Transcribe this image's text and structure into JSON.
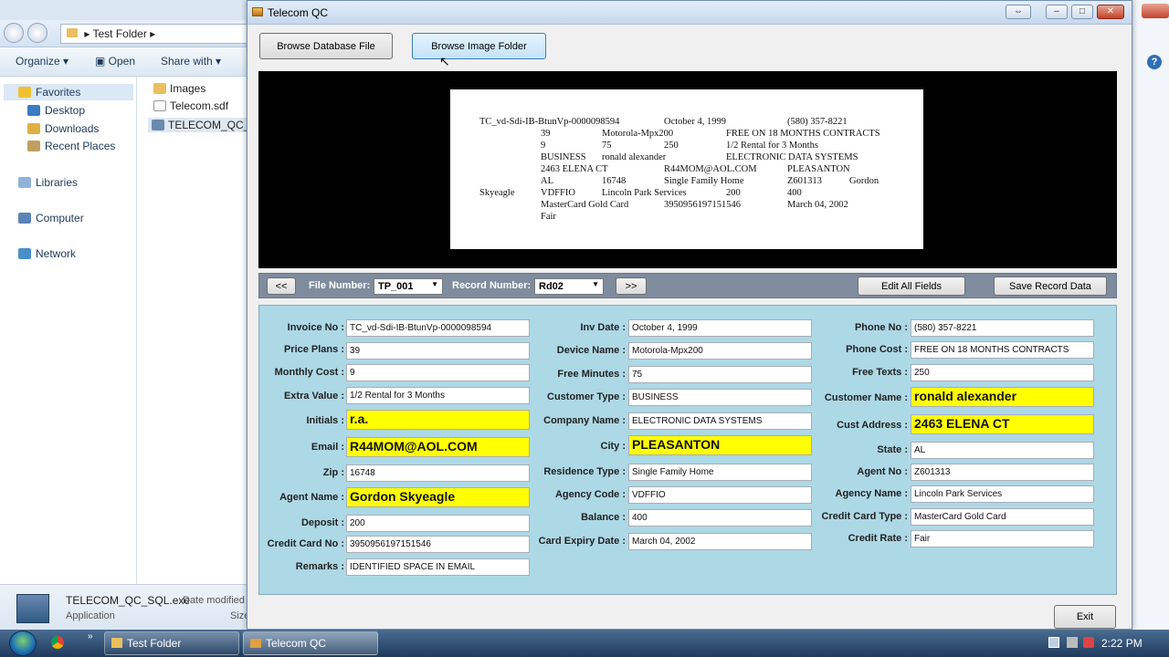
{
  "explorer": {
    "path": [
      "Test Folder"
    ],
    "toolbar": {
      "organize": "Organize",
      "open": "Open",
      "share": "Share with"
    },
    "nav": [
      "Favorites",
      "Desktop",
      "Downloads",
      "Recent Places",
      "Libraries",
      "Computer",
      "Network"
    ],
    "files": [
      "Images",
      "Telecom.sdf",
      "TELECOM_QC_SQ"
    ],
    "details": {
      "name": "TELECOM_QC_SQL.exe",
      "meta": "Date modified",
      "type": "Application",
      "size": "Size"
    }
  },
  "window": {
    "title": "Telecom QC",
    "buttons": {
      "browse_db": "Browse Database File",
      "browse_img": "Browse Image Folder",
      "prev": "<<",
      "next": ">>",
      "edit_all": "Edit All Fields",
      "save": "Save Record Data",
      "exit": "Exit"
    },
    "nav": {
      "file_label": "File Number:",
      "file_value": "TP_001",
      "record_label": "Record Number:",
      "record_value": "Rd02"
    },
    "document_lines": [
      [
        "TC_vd-Sdi-IB-BtunVp-0000098594",
        "October 4, 1999",
        "(580) 357-8221"
      ],
      [
        "39",
        "Motorola-Mpx200",
        "FREE ON 18 MONTHS CONTRACTS"
      ],
      [
        "9",
        "75",
        "250",
        "1/2 Rental for 3 Months"
      ],
      [
        "BUSINESS",
        "ronald alexander",
        "ELECTRONIC DATA SYSTEMS"
      ],
      [
        "2463 ELENA CT",
        "R44MOM@AOL.COM",
        "PLEASANTON"
      ],
      [
        "AL",
        "16748",
        "Single Family Home",
        "Z601313",
        "Gordon"
      ],
      [
        "Skyeagle",
        "VDFFIO",
        "Lincoln Park Services",
        "200",
        "400"
      ],
      [
        "MasterCard Gold Card",
        "3950956197151546",
        "March 04, 2002"
      ],
      [
        "Fair"
      ]
    ],
    "fields": {
      "invoice_no": {
        "label": "Invoice No :",
        "value": "TC_vd-Sdi-IB-BtunVp-0000098594"
      },
      "price_plans": {
        "label": "Price Plans :",
        "value": "39"
      },
      "monthly_cost": {
        "label": "Monthly Cost :",
        "value": "9"
      },
      "extra_value": {
        "label": "Extra Value :",
        "value": "1/2 Rental for 3 Months"
      },
      "initials": {
        "label": "Initials :",
        "value": "r.a."
      },
      "email": {
        "label": "Email :",
        "value": "R44MOM@AOL.COM"
      },
      "zip": {
        "label": "Zip :",
        "value": "16748"
      },
      "agent_name": {
        "label": "Agent Name :",
        "value": "Gordon Skyeagle"
      },
      "deposit": {
        "label": "Deposit :",
        "value": "200"
      },
      "credit_card_no": {
        "label": "Credit Card No :",
        "value": "3950956197151546"
      },
      "remarks": {
        "label": "Remarks :",
        "value": "IDENTIFIED SPACE IN EMAIL"
      },
      "inv_date": {
        "label": "Inv Date :",
        "value": "October 4, 1999"
      },
      "device_name": {
        "label": "Device Name :",
        "value": "Motorola-Mpx200"
      },
      "free_minutes": {
        "label": "Free Minutes :",
        "value": "75"
      },
      "customer_type": {
        "label": "Customer Type :",
        "value": "BUSINESS"
      },
      "company_name": {
        "label": "Company Name :",
        "value": "ELECTRONIC DATA SYSTEMS"
      },
      "city": {
        "label": "City :",
        "value": "PLEASANTON"
      },
      "residence_type": {
        "label": "Residence Type :",
        "value": "Single Family Home"
      },
      "agency_code": {
        "label": "Agency Code :",
        "value": "VDFFIO"
      },
      "balance": {
        "label": "Balance :",
        "value": "400"
      },
      "card_expiry": {
        "label": "Card Expiry Date :",
        "value": "March 04, 2002"
      },
      "phone_no": {
        "label": "Phone No :",
        "value": "(580) 357-8221"
      },
      "phone_cost": {
        "label": "Phone Cost :",
        "value": "FREE ON 18 MONTHS CONTRACTS"
      },
      "free_texts": {
        "label": "Free Texts :",
        "value": "250"
      },
      "customer_name": {
        "label": "Customer Name :",
        "value": "ronald alexander"
      },
      "cust_address": {
        "label": "Cust Address :",
        "value": "2463 ELENA CT"
      },
      "state": {
        "label": "State :",
        "value": "AL"
      },
      "agent_no": {
        "label": "Agent No :",
        "value": "Z601313"
      },
      "agency_name": {
        "label": "Agency Name :",
        "value": "Lincoln Park Services"
      },
      "credit_card_type": {
        "label": "Credit Card Type :",
        "value": "MasterCard Gold Card"
      },
      "credit_rate": {
        "label": "Credit Rate :",
        "value": "Fair"
      }
    }
  },
  "taskbar": {
    "items": [
      "Test Folder",
      "Telecom QC"
    ],
    "clock": "2:22 PM"
  },
  "colors": {
    "form_bg": "#add8e6",
    "highlight": "#ffff00",
    "preview_bg": "#000000"
  }
}
